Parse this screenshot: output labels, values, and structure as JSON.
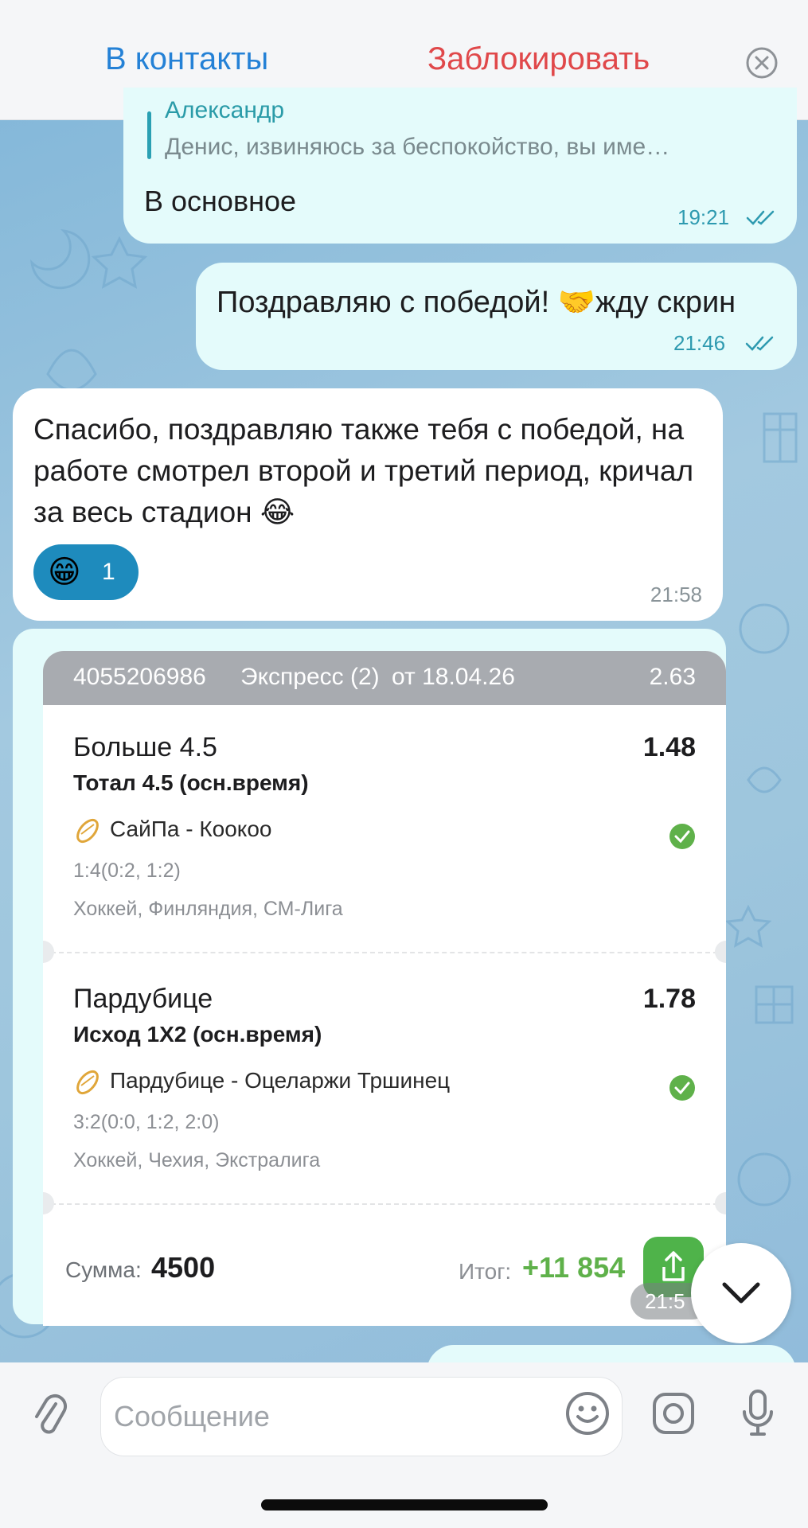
{
  "header": {
    "add_contact": "В контакты",
    "block": "Заблокировать",
    "close_icon": "close-circle-icon"
  },
  "messages": [
    {
      "direction": "outgoing",
      "reply": {
        "author": "Александр",
        "text": "Денис, извиняюсь за беспокойство, вы име…"
      },
      "text": "В основное",
      "time": "19:21",
      "status_icon": "double-check-icon"
    },
    {
      "direction": "outgoing",
      "text": "Поздравляю с победой! 🤝жду скрин",
      "time": "21:46",
      "status_icon": "double-check-icon"
    },
    {
      "direction": "incoming",
      "text": "Спасибо, поздравляю также тебя с победой, на работе смотрел второй и третий период, кричал за весь стадион 😂",
      "reaction": {
        "emoji": "😁",
        "count": "1"
      },
      "time": "21:58"
    }
  ],
  "bet_card": {
    "id": "4055206986",
    "type": "Экспресс (2)",
    "date": "от 18.04.26",
    "total_odds": "2.63",
    "selections": [
      {
        "pick": "Больше 4.5",
        "odds": "1.48",
        "market": "Тотал 4.5 (осн.время)",
        "match": "СайПа - Коокоо",
        "score": "1:4(0:2, 1:2)",
        "league": "Хоккей, Финляндия, СМ-Лига",
        "status": "won"
      },
      {
        "pick": "Пардубице",
        "odds": "1.78",
        "market": "Исход 1X2 (осн.время)",
        "match": "Пардубице - Оцеларжи Тршинец",
        "score": "3:2(0:0, 1:2, 2:0)",
        "league": "Хоккей, Чехия, Экстралига",
        "status": "won"
      }
    ],
    "sum_label": "Сумма:",
    "sum": "4500",
    "result_label": "Итог:",
    "result": "+11 854",
    "time": "21:5",
    "share_icon": "share-icon"
  },
  "input": {
    "placeholder": "Сообщение",
    "attach_icon": "paperclip-icon",
    "emoji_icon": "smile-icon",
    "camera_icon": "camera-icon",
    "mic_icon": "microphone-icon"
  },
  "scroll_down_icon": "chevron-down-icon",
  "colors": {
    "accent_blue": "#2481d6",
    "block_red": "#e0484a",
    "outgoing_bubble": "#e4fbfb",
    "win_green": "#5fb14a"
  }
}
